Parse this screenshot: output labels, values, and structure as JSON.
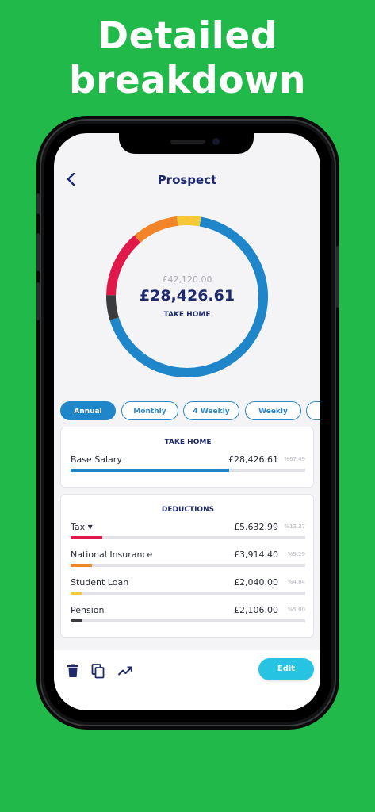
{
  "headline": {
    "line1": "Detailed",
    "line2": "breakdown"
  },
  "header": {
    "back_icon": "chevron-left-icon",
    "title": "Prospect"
  },
  "summary": {
    "gross": "£42,120.00",
    "net": "£28,426.61",
    "net_label": "TAKE HOME"
  },
  "tabs": [
    {
      "label": "Annual",
      "active": true
    },
    {
      "label": "Monthly",
      "active": false
    },
    {
      "label": "4 Weekly",
      "active": false
    },
    {
      "label": "Weekly",
      "active": false
    }
  ],
  "take_home": {
    "heading": "TAKE HOME",
    "rows": [
      {
        "label": "Base Salary",
        "value": "£28,426.61",
        "pct": "%67.49",
        "fraction": 0.6749,
        "color": "#1f86c9"
      }
    ]
  },
  "deductions": {
    "heading": "DEDUCTIONS",
    "rows": [
      {
        "label": "Tax",
        "value": "£5,632.99",
        "pct": "%13.37",
        "fraction": 0.1337,
        "color": "#e0194a",
        "has_dropdown": true
      },
      {
        "label": "National Insurance",
        "value": "£3,914.40",
        "pct": "%9.29",
        "fraction": 0.0929,
        "color": "#f2852a"
      },
      {
        "label": "Student Loan",
        "value": "£2,040.00",
        "pct": "%4.84",
        "fraction": 0.0484,
        "color": "#f6c737"
      },
      {
        "label": "Pension",
        "value": "£2,106.00",
        "pct": "%5.00",
        "fraction": 0.05,
        "color": "#3a3b3f"
      }
    ]
  },
  "donut_segments": [
    {
      "name": "Take Home",
      "fraction": 0.6749,
      "color": "#1f86c9"
    },
    {
      "name": "Pension",
      "fraction": 0.05,
      "color": "#3a3b3f"
    },
    {
      "name": "Tax",
      "fraction": 0.1337,
      "color": "#e0194a"
    },
    {
      "name": "National Insurance",
      "fraction": 0.0929,
      "color": "#f2852a"
    },
    {
      "name": "Student Loan",
      "fraction": 0.0484,
      "color": "#f6c737"
    }
  ],
  "toolbar": {
    "icons": [
      "trash-icon",
      "copy-icon",
      "trend-icon"
    ],
    "edit_label": "Edit"
  },
  "colors": {
    "background": "#20b94a",
    "navy": "#1f2a6e",
    "accent_blue": "#1f86c9",
    "edit_button": "#27c3e3"
  }
}
